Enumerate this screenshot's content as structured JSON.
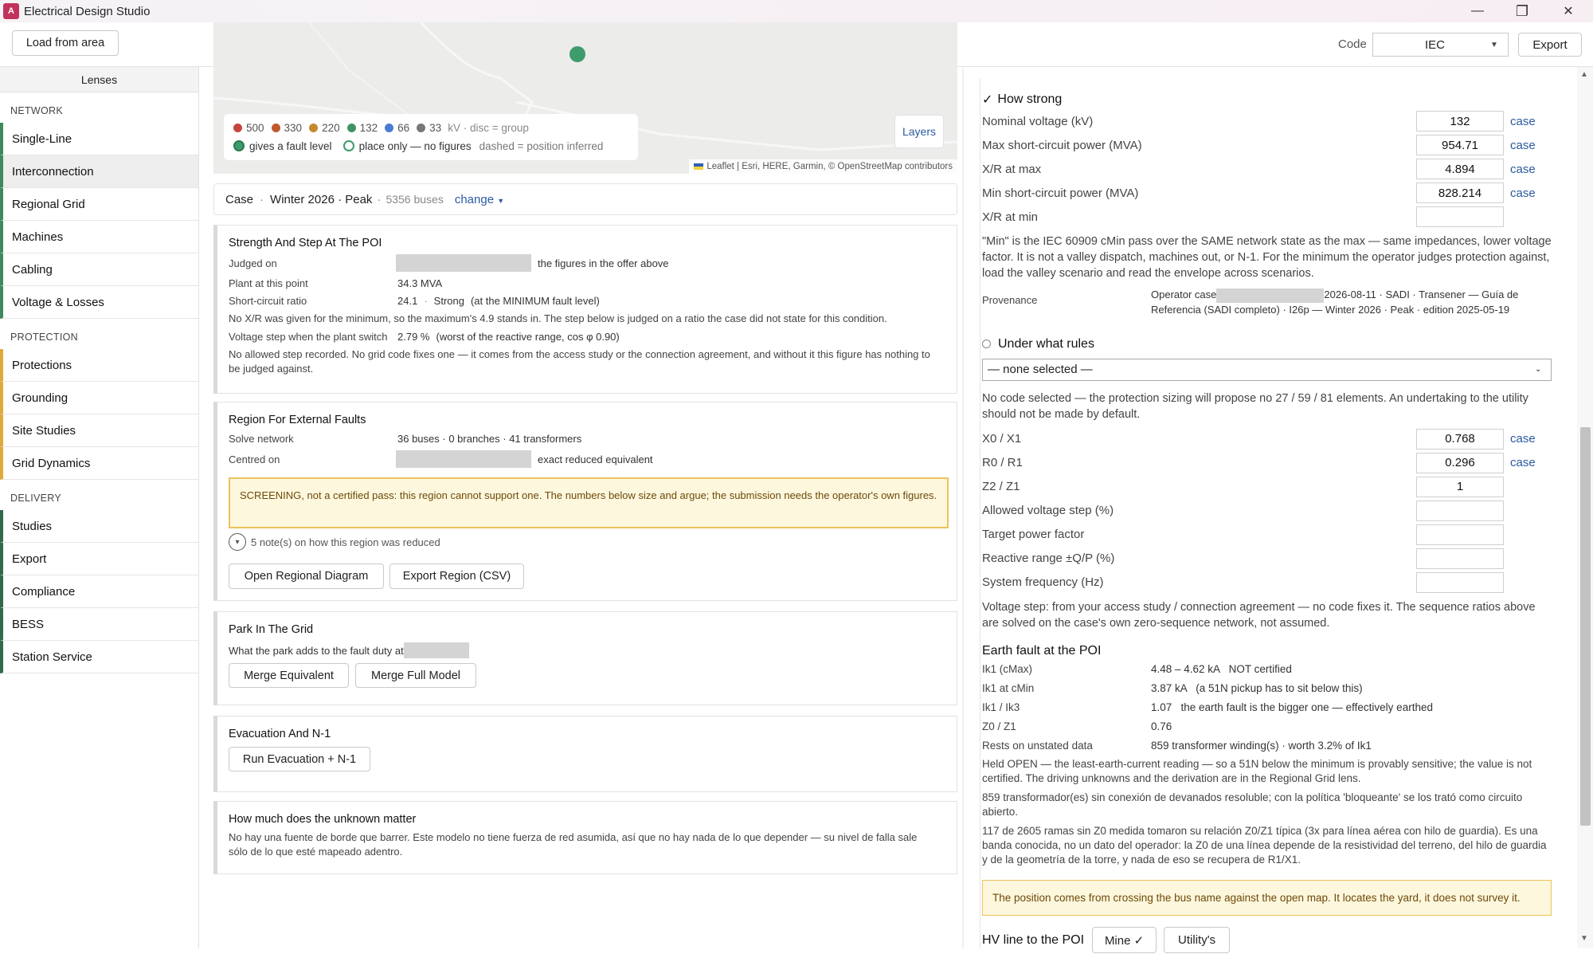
{
  "app": {
    "title": "Electrical Design Studio",
    "icon_letter": "A"
  },
  "window": {
    "min": "—",
    "max": "❐",
    "close": "✕"
  },
  "toolbar": {
    "load_label": "Load from area",
    "code_label": "Code",
    "code_value": "IEC",
    "export_label": "Export"
  },
  "sidebar": {
    "head": "Lenses",
    "sections": [
      {
        "title": "NETWORK",
        "items": [
          "Single-Line",
          "Interconnection",
          "Regional Grid",
          "Machines",
          "Cabling",
          "Voltage & Losses"
        ]
      },
      {
        "title": "PROTECTION",
        "items": [
          "Protections",
          "Grounding",
          "Site Studies",
          "Grid Dynamics"
        ]
      },
      {
        "title": "DELIVERY",
        "items": [
          "Studies",
          "Export",
          "Compliance",
          "BESS",
          "Station Service"
        ]
      }
    ],
    "active": "Interconnection",
    "colors": {
      "network": "#3f8a5a",
      "protection": "#e0a93a",
      "delivery": "#2f6b4a"
    }
  },
  "map": {
    "legend": {
      "kv": [
        "500",
        "330",
        "220",
        "132",
        "66",
        "33"
      ],
      "kv_unit": "kV · disc = group",
      "fault": "gives a fault level",
      "place": "place only — no figures",
      "dashed": "dashed = position inferred"
    },
    "kv_colors": [
      "#c8433c",
      "#c0592f",
      "#c3892f",
      "#3f9467",
      "#4a7bd0",
      "#777777"
    ],
    "layers": "Layers",
    "attribution": "Leaflet | Esri, HERE, Garmin, © OpenStreetMap contributors"
  },
  "case": {
    "label": "Case",
    "name": "Winter 2026 · Peak",
    "buses": "5356 buses",
    "change": "change"
  },
  "strength": {
    "title": "Strength And Step At The POI",
    "judged_k": "Judged on",
    "judged_v": "the figures in the offer above",
    "plant_k": "Plant at this point",
    "plant_v": "34.3 MVA",
    "scr_k": "Short-circuit ratio",
    "scr_v": "24.1",
    "scr_strength": "Strong",
    "scr_note": "(at the MINIMUM fault level)",
    "xr_note": "No X/R was given for the minimum, so the maximum's 4.9 stands in. The step below is judged on a ratio the case did not state for this condition.",
    "step_k": "Voltage step when the plant switch",
    "step_v": "2.79 %",
    "step_note": "(worst of the reactive range, cos φ 0.90)",
    "allowed_note": "No allowed step recorded. No grid code fixes one — it comes from the access study or the connection agreement, and without it this figure has nothing to be judged against."
  },
  "region": {
    "title": "Region For External Faults",
    "solve_k": "Solve network",
    "solve_v": "36 buses · 0 branches · 41 transformers",
    "centred_k": "Centred on",
    "centred_v": "exact reduced equivalent",
    "warning": "SCREENING, not a certified pass: this region cannot support one. The numbers below size and argue; the submission needs the operator's own figures.",
    "notes": "5 note(s) on how this region was reduced",
    "open_btn": "Open Regional Diagram",
    "export_btn": "Export Region (CSV)"
  },
  "park": {
    "title": "Park In The Grid",
    "desc": "What the park adds to the fault duty at",
    "merge_eq": "Merge Equivalent",
    "merge_full": "Merge Full Model"
  },
  "evac": {
    "title": "Evacuation And N-1",
    "run": "Run Evacuation + N-1"
  },
  "unknown": {
    "title": "How much does the unknown matter",
    "text": "No hay una fuente de borde que barrer. Este modelo no tiene fuerza de red asumida, así que no hay nada de lo que depender — su nivel de falla sale sólo de lo que esté mapeado adentro."
  },
  "how_strong": {
    "check": "✓",
    "title": "How strong",
    "fields": [
      {
        "label": "Nominal voltage (kV)",
        "value": "132",
        "case": "case"
      },
      {
        "label": "Max short-circuit power (MVA)",
        "value": "954.71",
        "case": "case"
      },
      {
        "label": "X/R at max",
        "value": "4.894",
        "case": "case"
      },
      {
        "label": "Min short-circuit power (MVA)",
        "value": "828.214",
        "case": "case"
      },
      {
        "label": "X/R at min",
        "value": "",
        "case": ""
      }
    ],
    "min_note": "\"Min\" is the IEC 60909 cMin pass over the SAME network state as the max — same impedances, lower voltage factor. It is not a valley dispatch, machines out, or N-1. For the minimum the operator judges protection against, load the valley scenario and read the envelope across scenarios.",
    "prov_k": "Provenance",
    "prov_a": "Operator case",
    "prov_b": "2026-08-11 · SADI · Transener — Guía de",
    "prov_c": "Referencia (SADI completo) · I26p — Winter 2026 · Peak · edition 2025-05-19"
  },
  "rules": {
    "title": "Under what rules",
    "select": "— none selected —",
    "note": "No code selected — the protection sizing will propose no 27 / 59 / 81 elements. An undertaking to the utility should not be made by default.",
    "fields": [
      {
        "label": "X0 / X1",
        "value": "0.768",
        "case": "case"
      },
      {
        "label": "R0 / R1",
        "value": "0.296",
        "case": "case"
      },
      {
        "label": "Z2 / Z1",
        "value": "1",
        "case": ""
      },
      {
        "label": "Allowed voltage step (%)",
        "value": "",
        "case": ""
      },
      {
        "label": "Target power factor",
        "value": "",
        "case": ""
      },
      {
        "label": "Reactive range ±Q/P (%)",
        "value": "",
        "case": ""
      },
      {
        "label": "System frequency (Hz)",
        "value": "",
        "case": ""
      }
    ],
    "step_note": "Voltage step: from your access study / connection agreement — no code fixes it. The sequence ratios above are solved on the case's own zero-sequence network, not assumed."
  },
  "earth": {
    "title": "Earth fault at the POI",
    "rows": [
      {
        "k": "Ik1 (cMax)",
        "v": "4.48 – 4.62 kA   NOT certified"
      },
      {
        "k": "Ik1 at cMin",
        "v": "3.87 kA   (a 51N pickup has to sit below this)"
      },
      {
        "k": "Ik1 / Ik3",
        "v": "1.07   the earth fault is the bigger one — effectively earthed"
      },
      {
        "k": "Z0 / Z1",
        "v": "0.76"
      },
      {
        "k": "Rests on unstated data",
        "v": "859 transformer winding(s) · worth 3.2% of Ik1"
      }
    ],
    "held": "Held OPEN — the least-earth-current reading — so a 51N below the minimum is provably sensitive; the value is not certified. The driving unknowns and the derivation are in the Regional Grid lens.",
    "spanish1": "859 transformador(es) sin conexión de devanados resoluble; con la política 'bloqueante' se los trató como circuito abierto.",
    "spanish2": "117 de 2605 ramas sin Z0 medida tomaron su relación Z0/Z1 típica (3x para línea aérea con hilo de guardia). Es una banda conocida, no un dato del operador: la Z0 de una línea depende de la resistividad del terreno, del hilo de guardia y de la geometría de la torre, y nada de eso se recupera de R1/X1.",
    "position": "The position comes from crossing the bus name against the open map. It locates the yard, it does not survey it."
  },
  "hv": {
    "label": "HV line to the POI",
    "mine": "Mine ✓",
    "utility": "Utility's"
  }
}
